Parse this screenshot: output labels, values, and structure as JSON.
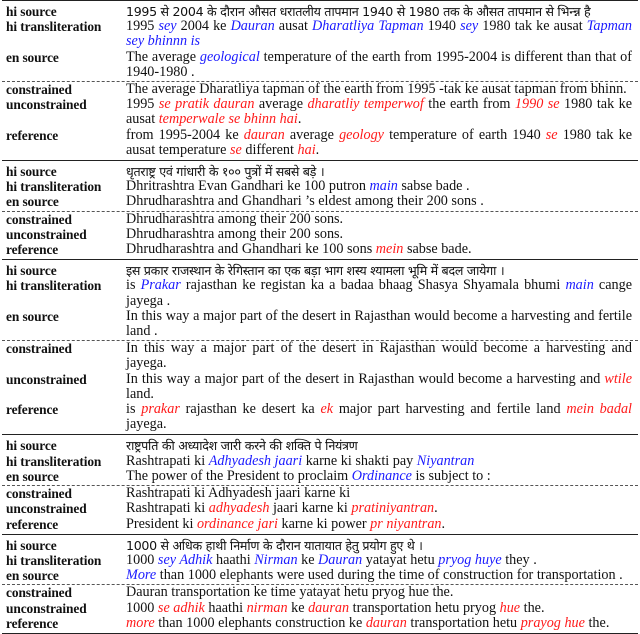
{
  "labels": {
    "hi_source": "hi source",
    "hi_transliteration": "hi transliteration",
    "en_source": "en source",
    "constrained": "constrained",
    "unconstrained": "unconstrained",
    "reference": "reference"
  },
  "colors": {
    "source_highlight": "#1a1aff",
    "error_highlight": "#ff1a1a"
  },
  "examples": [
    {
      "hi_source": [
        {
          "t": "1995 से 2004 के दौरान औसत धरातलीय तापमान 1940 से 1980 तक के औसत तापमान से भिन्न्न है"
        }
      ],
      "hi_transliteration": [
        {
          "t": "1995 "
        },
        {
          "t": "sey",
          "c": "b"
        },
        {
          "t": " 2004 ke "
        },
        {
          "t": "Dauran",
          "c": "b"
        },
        {
          "t": " ausat "
        },
        {
          "t": "Dharatliya Tapman",
          "c": "b"
        },
        {
          "t": " 1940 "
        },
        {
          "t": "sey",
          "c": "b"
        },
        {
          "t": " 1980 tak ke ausat "
        },
        {
          "t": "Tapman sey bhinnn is",
          "c": "b"
        }
      ],
      "en_source": [
        {
          "t": "The average "
        },
        {
          "t": "geological",
          "c": "b"
        },
        {
          "t": " temperature of the earth from 1995-2004 is different than that of 1940-1980 ."
        }
      ],
      "constrained": [
        {
          "t": "The average Dharatliya tapman of the earth from 1995 -tak ke ausat tapman from bhinn."
        }
      ],
      "unconstrained": [
        {
          "t": "1995 "
        },
        {
          "t": "se pratik dauran",
          "c": "r"
        },
        {
          "t": " average "
        },
        {
          "t": "dharatliy temperwof",
          "c": "r"
        },
        {
          "t": " the earth from "
        },
        {
          "t": "1990 se",
          "c": "r"
        },
        {
          "t": " 1980 tak ke ausat "
        },
        {
          "t": "temperwale se bhinn hai",
          "c": "r"
        },
        {
          "t": "."
        }
      ],
      "reference": [
        {
          "t": "from 1995-2004 ke "
        },
        {
          "t": "dauran",
          "c": "r"
        },
        {
          "t": " average "
        },
        {
          "t": "geology",
          "c": "r"
        },
        {
          "t": " temperature of earth 1940 "
        },
        {
          "t": "se",
          "c": "r"
        },
        {
          "t": " 1980 tak ke ausat temperature "
        },
        {
          "t": "se",
          "c": "r"
        },
        {
          "t": " different "
        },
        {
          "t": "hai",
          "c": "r"
        },
        {
          "t": "."
        }
      ]
    },
    {
      "hi_source": [
        {
          "t": "धृतराष्ट्र एवं गांधारी के १०० पुत्रों में सबसे बड़े ।"
        }
      ],
      "hi_transliteration": [
        {
          "t": "Dhritrashtra Evan Gandhari ke 100 putron "
        },
        {
          "t": "main",
          "c": "b"
        },
        {
          "t": " sabse bade ."
        }
      ],
      "en_source": [
        {
          "t": "Dhrudharashtra and Ghandhari ’s eldest among their 200 sons ."
        }
      ],
      "constrained": [
        {
          "t": "Dhrudharashtra among their 200 sons."
        }
      ],
      "unconstrained": [
        {
          "t": "Dhrudharashtra among their 200 sons."
        }
      ],
      "reference": [
        {
          "t": "Dhrudharashtra and Ghandhari ke 100 sons "
        },
        {
          "t": "mein",
          "c": "r"
        },
        {
          "t": " sabse bade."
        }
      ]
    },
    {
      "hi_source": [
        {
          "t": "इस प्रकार राजस्थान के रेगिस्तान का एक बड़ा भाग शस्य श्यामला भूमि में बदल जायेगा ।"
        }
      ],
      "hi_transliteration": [
        {
          "t": "is "
        },
        {
          "t": "Prakar",
          "c": "b"
        },
        {
          "t": " rajasthan ke registan ka a badaa bhaag Shasya Shyamala bhumi "
        },
        {
          "t": "main",
          "c": "b"
        },
        {
          "t": " cange jayega ."
        }
      ],
      "en_source": [
        {
          "t": "In this way a major part of the desert in Rajasthan would become a harvesting and fertile land ."
        }
      ],
      "constrained": [
        {
          "t": "In this way a major part of the desert in Rajasthan would become a harvesting and jayega."
        }
      ],
      "unconstrained": [
        {
          "t": "In this way a major part of the desert in Rajasthan would become a harvesting and "
        },
        {
          "t": "wtile",
          "c": "r"
        },
        {
          "t": " land."
        }
      ],
      "reference": [
        {
          "t": "is "
        },
        {
          "t": "prakar",
          "c": "r"
        },
        {
          "t": " rajasthan ke desert ka "
        },
        {
          "t": "ek",
          "c": "r"
        },
        {
          "t": " major part harvesting and fertile land "
        },
        {
          "t": "mein badal",
          "c": "r"
        },
        {
          "t": " jayega."
        }
      ]
    },
    {
      "hi_source": [
        {
          "t": "राष्ट्रपति की अध्यादेश जारी करने की शक्ति पे नियंत्रण"
        }
      ],
      "hi_transliteration": [
        {
          "t": "Rashtrapati ki "
        },
        {
          "t": "Adhyadesh jaari",
          "c": "b"
        },
        {
          "t": " karne ki shakti pay "
        },
        {
          "t": "Niyantran",
          "c": "b"
        }
      ],
      "en_source": [
        {
          "t": "The power of the President to proclaim "
        },
        {
          "t": "Ordinance",
          "c": "b"
        },
        {
          "t": " is subject to :"
        }
      ],
      "constrained": [
        {
          "t": "Rashtrapati ki Adhyadesh jaari karne ki"
        }
      ],
      "unconstrained": [
        {
          "t": "Rashtrapati ki "
        },
        {
          "t": "adhyadesh",
          "c": "r"
        },
        {
          "t": " jaari karne ki "
        },
        {
          "t": "pratiniyantran",
          "c": "r"
        },
        {
          "t": "."
        }
      ],
      "reference": [
        {
          "t": "President ki "
        },
        {
          "t": "ordinance jari",
          "c": "r"
        },
        {
          "t": " karne ki power "
        },
        {
          "t": "pr niyantran",
          "c": "r"
        },
        {
          "t": "."
        }
      ]
    },
    {
      "hi_source": [
        {
          "t": "1000 से अधिक हाथी निर्माण के दौरान यातायात हेतु प्रयोग हुए थे ।"
        }
      ],
      "hi_transliteration": [
        {
          "t": "1000 "
        },
        {
          "t": "sey Adhik",
          "c": "b"
        },
        {
          "t": " haathi "
        },
        {
          "t": "Nirman",
          "c": "b"
        },
        {
          "t": " ke "
        },
        {
          "t": "Dauran",
          "c": "b"
        },
        {
          "t": " yatayat hetu "
        },
        {
          "t": "pryog huye",
          "c": "b"
        },
        {
          "t": " they ."
        }
      ],
      "en_source": [
        {
          "t": "More",
          "c": "b"
        },
        {
          "t": " than 1000 elephants were used during the time of construction for transportation ."
        }
      ],
      "constrained": [
        {
          "t": "Dauran transportation ke time yatayat hetu pryog hue the."
        }
      ],
      "unconstrained": [
        {
          "t": "1000 "
        },
        {
          "t": "se adhik",
          "c": "r"
        },
        {
          "t": " haathi "
        },
        {
          "t": "nirman",
          "c": "r"
        },
        {
          "t": " ke "
        },
        {
          "t": "dauran",
          "c": "r"
        },
        {
          "t": " transportation hetu pryog "
        },
        {
          "t": "hue",
          "c": "r"
        },
        {
          "t": " the."
        }
      ],
      "reference": [
        {
          "t": "more",
          "c": "r"
        },
        {
          "t": " than 1000 elephants construction ke "
        },
        {
          "t": "dauran",
          "c": "r"
        },
        {
          "t": " transportation hetu "
        },
        {
          "t": "prayog hue",
          "c": "r"
        },
        {
          "t": " the."
        }
      ]
    }
  ]
}
